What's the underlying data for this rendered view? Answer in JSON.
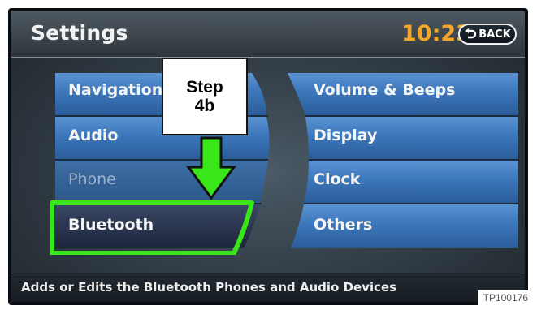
{
  "header": {
    "title": "Settings",
    "time": "10:23",
    "back_label": "BACK"
  },
  "menu": {
    "left": [
      {
        "label": "Navigation",
        "enabled": true
      },
      {
        "label": "Audio",
        "enabled": true
      },
      {
        "label": "Phone",
        "enabled": false
      },
      {
        "label": "Bluetooth",
        "enabled": true,
        "selected": true
      }
    ],
    "right": [
      {
        "label": "Volume & Beeps"
      },
      {
        "label": "Display"
      },
      {
        "label": "Clock"
      },
      {
        "label": "Others"
      }
    ]
  },
  "callout": {
    "line1": "Step",
    "line2": "4b",
    "highlight_color": "#39e619"
  },
  "footer": {
    "help_text": "Adds or Edits the Bluetooth Phones and Audio Devices"
  },
  "figure_id": "TP100176",
  "colors": {
    "clock": "#f3a72a",
    "button_blue": "#3a74b8",
    "selected_dark": "#26314b"
  }
}
